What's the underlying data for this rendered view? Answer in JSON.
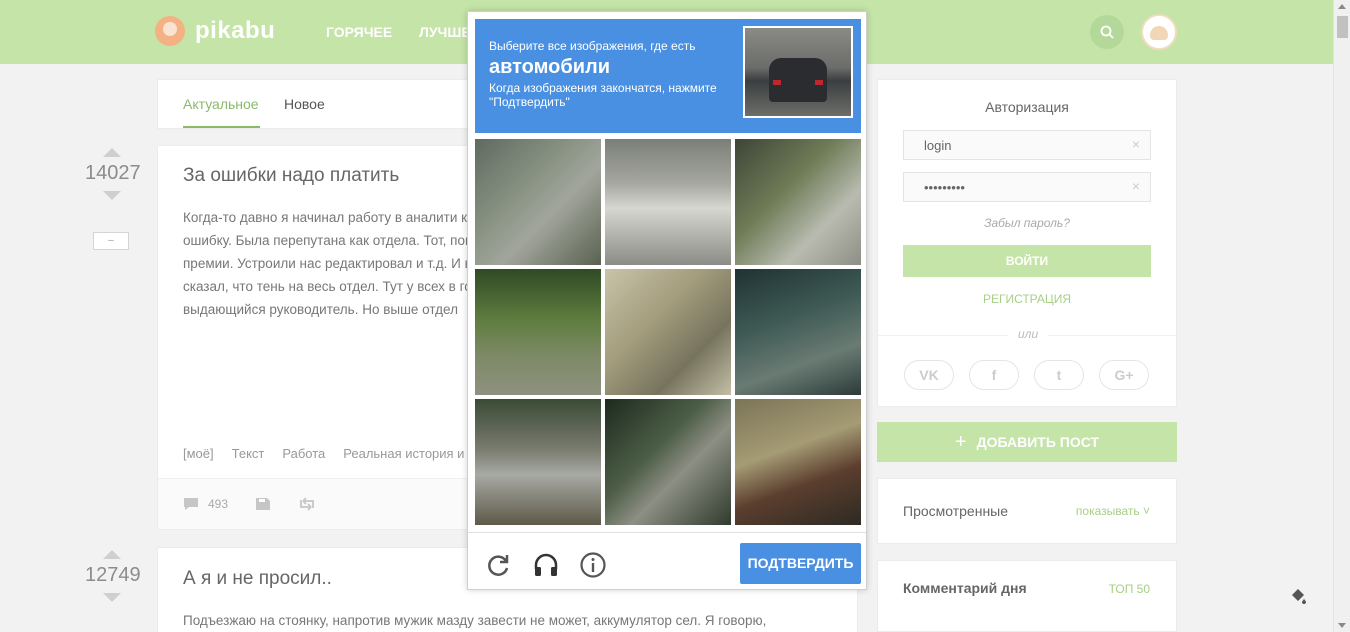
{
  "header": {
    "logo_text": "pikabu",
    "nav": [
      "ГОРЯЧЕЕ",
      "ЛУЧШЕЕ"
    ]
  },
  "tabs": [
    "Актуальное",
    "Новое"
  ],
  "posts": [
    {
      "score": "14027",
      "title": "За ошибки надо платить",
      "body": "Когда-то давно я начинал работу в аналити ковырял одну рабочую модель прогноза - у техническую ошибку. Была перепутана как отдела. Тот, поняв, уровень глупости ошибк лишить квартальной премии. Устроили нас редактировал и т.д. И вдруг выясняется, чт сделал? На ближайшей летучке сказал, что тень на весь отдел. Тут у всех в голове нехо квартальную премию начальник решил отд выдающийся руководитель. Но выше отдел",
      "tags": [
        "[моё]",
        "Текст",
        "Работа",
        "Реальная история и"
      ],
      "comments": "493",
      "collapse": "–"
    },
    {
      "score": "12749",
      "title": "А я и не просил..",
      "body": "Подъезжаю на стоянку, напротив мужик мазду завести не может, аккумулятор сел. Я говорю,"
    }
  ],
  "auth": {
    "title": "Авторизация",
    "login_value": "login",
    "password_value": "•••••••••",
    "clear": "×",
    "forgot": "Забыл пароль?",
    "login_button": "ВОЙТИ",
    "register": "РЕГИСТРАЦИЯ",
    "or": "или",
    "social": [
      "VK",
      "f",
      "t",
      "G+"
    ]
  },
  "sidebar": {
    "add_post": "ДОБАВИТЬ ПОСТ",
    "plus": "+",
    "viewed_label": "Просмотренные",
    "viewed_link": "показывать ˅",
    "comment_day": "Комментарий дня",
    "top50": "ТОП 50"
  },
  "captcha": {
    "line1": "Выберите все изображения, где есть",
    "target": "автомобили",
    "line3": "Когда изображения закончатся, нажмите \"Подтвердить\"",
    "verify_button": "ПОДТВЕРДИТЬ",
    "tiles_count": 9
  },
  "colors": {
    "header_green": "#c5e4a8",
    "accent_green": "#8ab96a",
    "captcha_blue": "#4a90e2"
  }
}
